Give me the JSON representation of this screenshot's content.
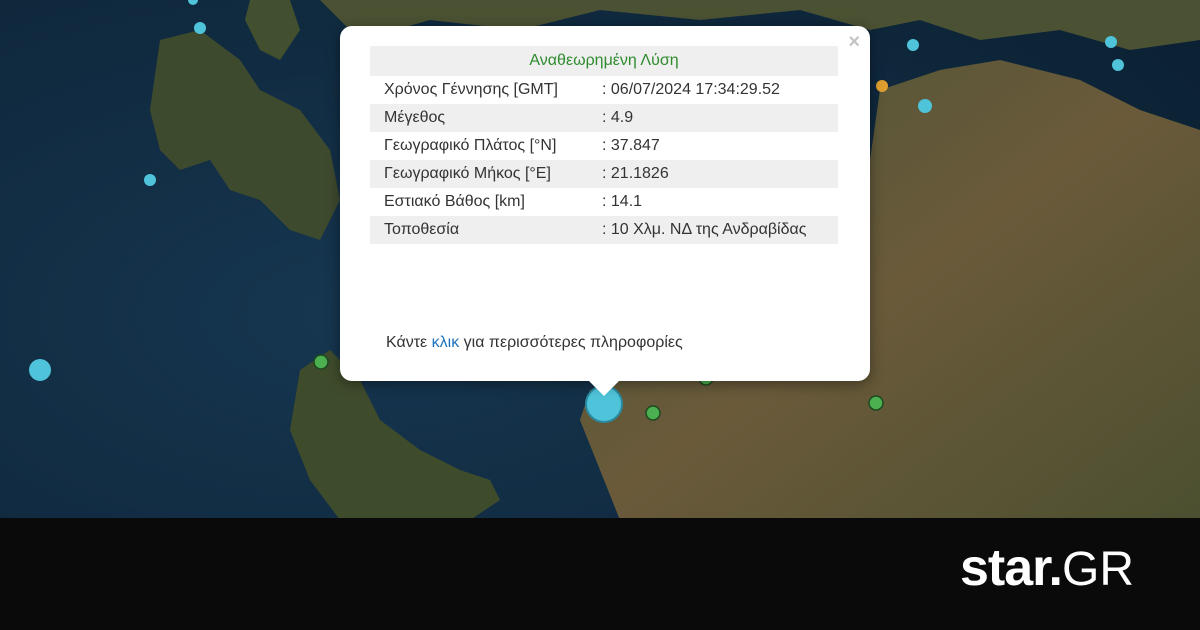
{
  "popup": {
    "title": "Αναθεωρημένη Λύση",
    "close_glyph": "×",
    "rows": [
      {
        "label": "Χρόνος Γέννησης [GMT]",
        "value": ": 06/07/2024 17:34:29.52"
      },
      {
        "label": "Μέγεθος",
        "value": ": 4.9"
      },
      {
        "label": "Γεωγραφικό Πλάτος [°N]",
        "value": ": 37.847"
      },
      {
        "label": "Γεωγραφικό Μήκος [°E]",
        "value": ": 21.1826"
      },
      {
        "label": "Εστιακό Βάθος [km]",
        "value": ": 14.1"
      },
      {
        "label": "Τοποθεσία",
        "value": ": 10 Χλμ. ΝΔ της Ανδραβίδας"
      }
    ],
    "more_before": "Κάντε",
    "more_link": "κλικ",
    "more_after": "για περισσότερες πληροφορίες"
  },
  "brand": {
    "name": "star",
    "suffix": "GR"
  },
  "colors": {
    "sea": "#10293d",
    "land": "#3d4a2c",
    "marker_cyan": "#4fc3d9",
    "marker_green": "#4caf50",
    "marker_orange": "#e0a030",
    "title_green": "#2e8b2e",
    "link_blue": "#1e73be"
  }
}
